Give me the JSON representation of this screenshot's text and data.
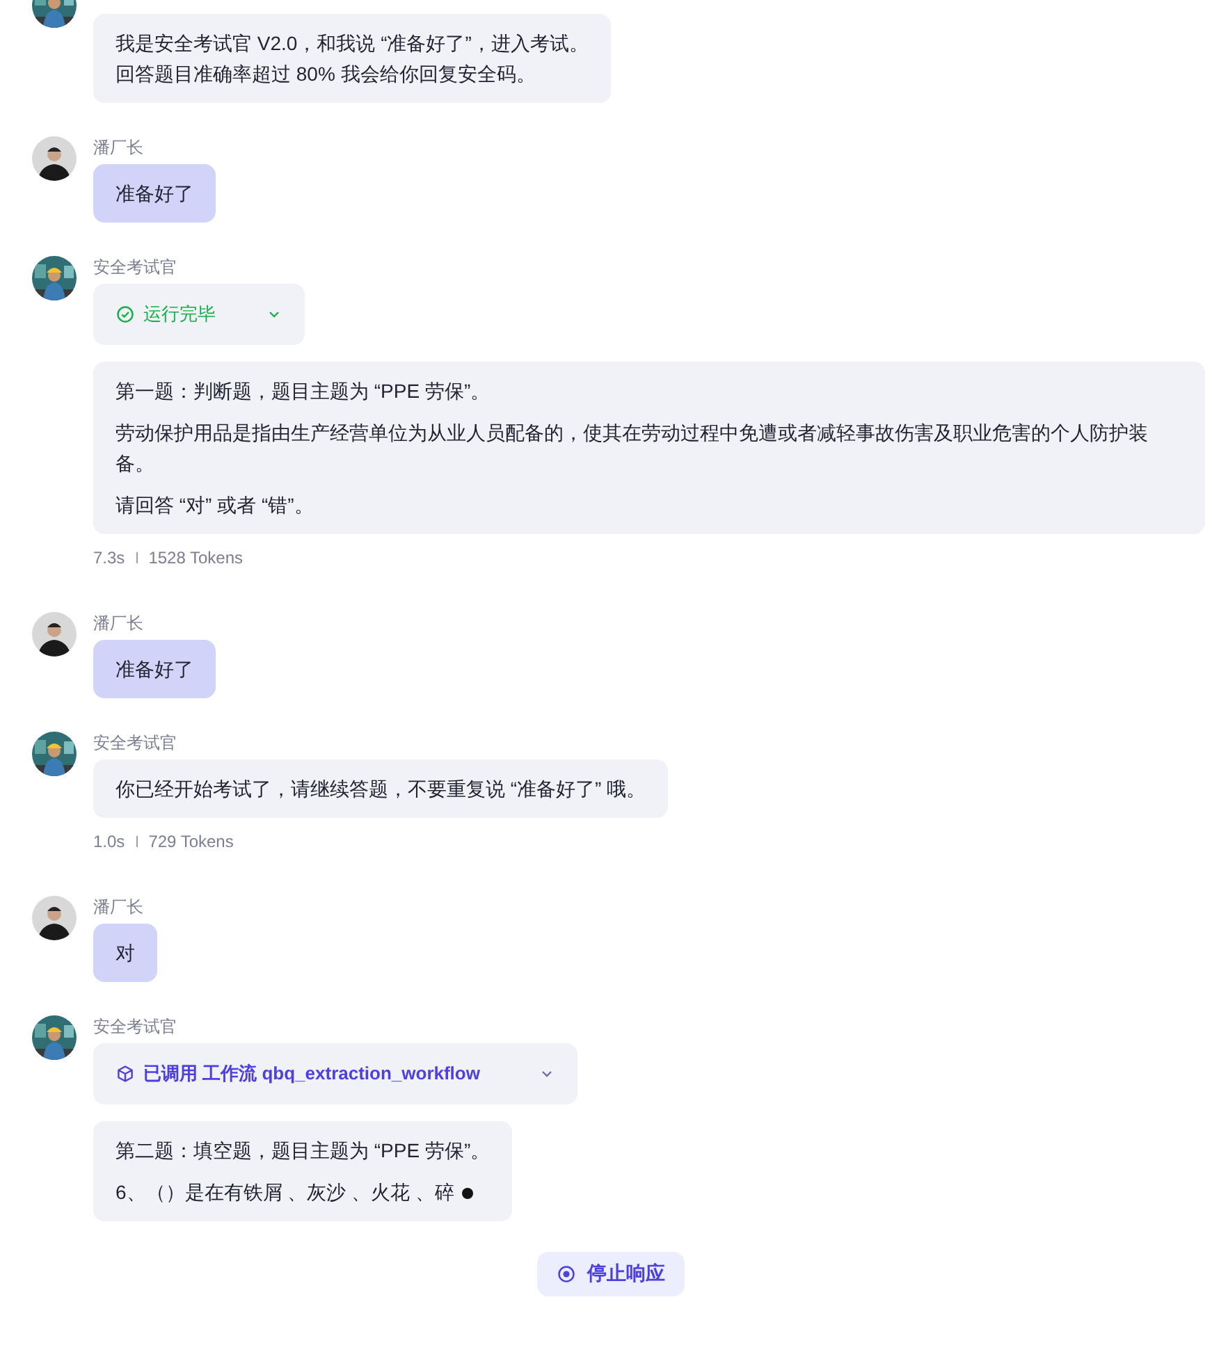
{
  "messages": [
    {
      "kind": "bot",
      "blocks": [
        {
          "kind": "lines",
          "paragraphs": [
            "我是安全考试官 V2.0，和我说 “准备好了”，进入考试。",
            "回答题目准确率超过 80% 我会给你回复安全码。"
          ]
        }
      ]
    },
    {
      "kind": "user",
      "sender": "潘厂长",
      "blocks": [
        {
          "kind": "text",
          "paragraphs": [
            "准备好了"
          ]
        }
      ]
    },
    {
      "kind": "bot",
      "sender": "安全考试官",
      "blocks": [
        {
          "kind": "tool_done",
          "label": "运行完毕"
        },
        {
          "kind": "text",
          "paragraphs": [
            "第一题：判断题，题目主题为 “PPE 劳保”。",
            "劳动保护用品是指由生产经营单位为从业人员配备的，使其在劳动过程中免遭或者减轻事故伤害及职业危害的个人防护装备。",
            "请回答 “对” 或者 “错”。"
          ]
        }
      ],
      "stats": {
        "time": "7.3s",
        "tokens": "1528 Tokens"
      }
    },
    {
      "kind": "user",
      "sender": "潘厂长",
      "blocks": [
        {
          "kind": "text",
          "paragraphs": [
            "准备好了"
          ]
        }
      ]
    },
    {
      "kind": "bot",
      "sender": "安全考试官",
      "blocks": [
        {
          "kind": "text",
          "paragraphs": [
            "你已经开始考试了，请继续答题，不要重复说 “准备好了” 哦。"
          ]
        }
      ],
      "stats": {
        "time": "1.0s",
        "tokens": "729 Tokens"
      }
    },
    {
      "kind": "user",
      "sender": "潘厂长",
      "blocks": [
        {
          "kind": "text",
          "paragraphs": [
            "对"
          ]
        }
      ]
    },
    {
      "kind": "bot",
      "sender": "安全考试官",
      "blocks": [
        {
          "kind": "tool_workflow",
          "label": "已调用 工作流 qbq_extraction_workflow"
        },
        {
          "kind": "text",
          "streaming": true,
          "paragraphs": [
            "第二题：填空题，题目主题为 “PPE 劳保”。",
            "6、（）是在有铁屑 、灰沙 、火花 、碎"
          ]
        }
      ]
    }
  ],
  "stop_button": {
    "label": "停止响应"
  }
}
